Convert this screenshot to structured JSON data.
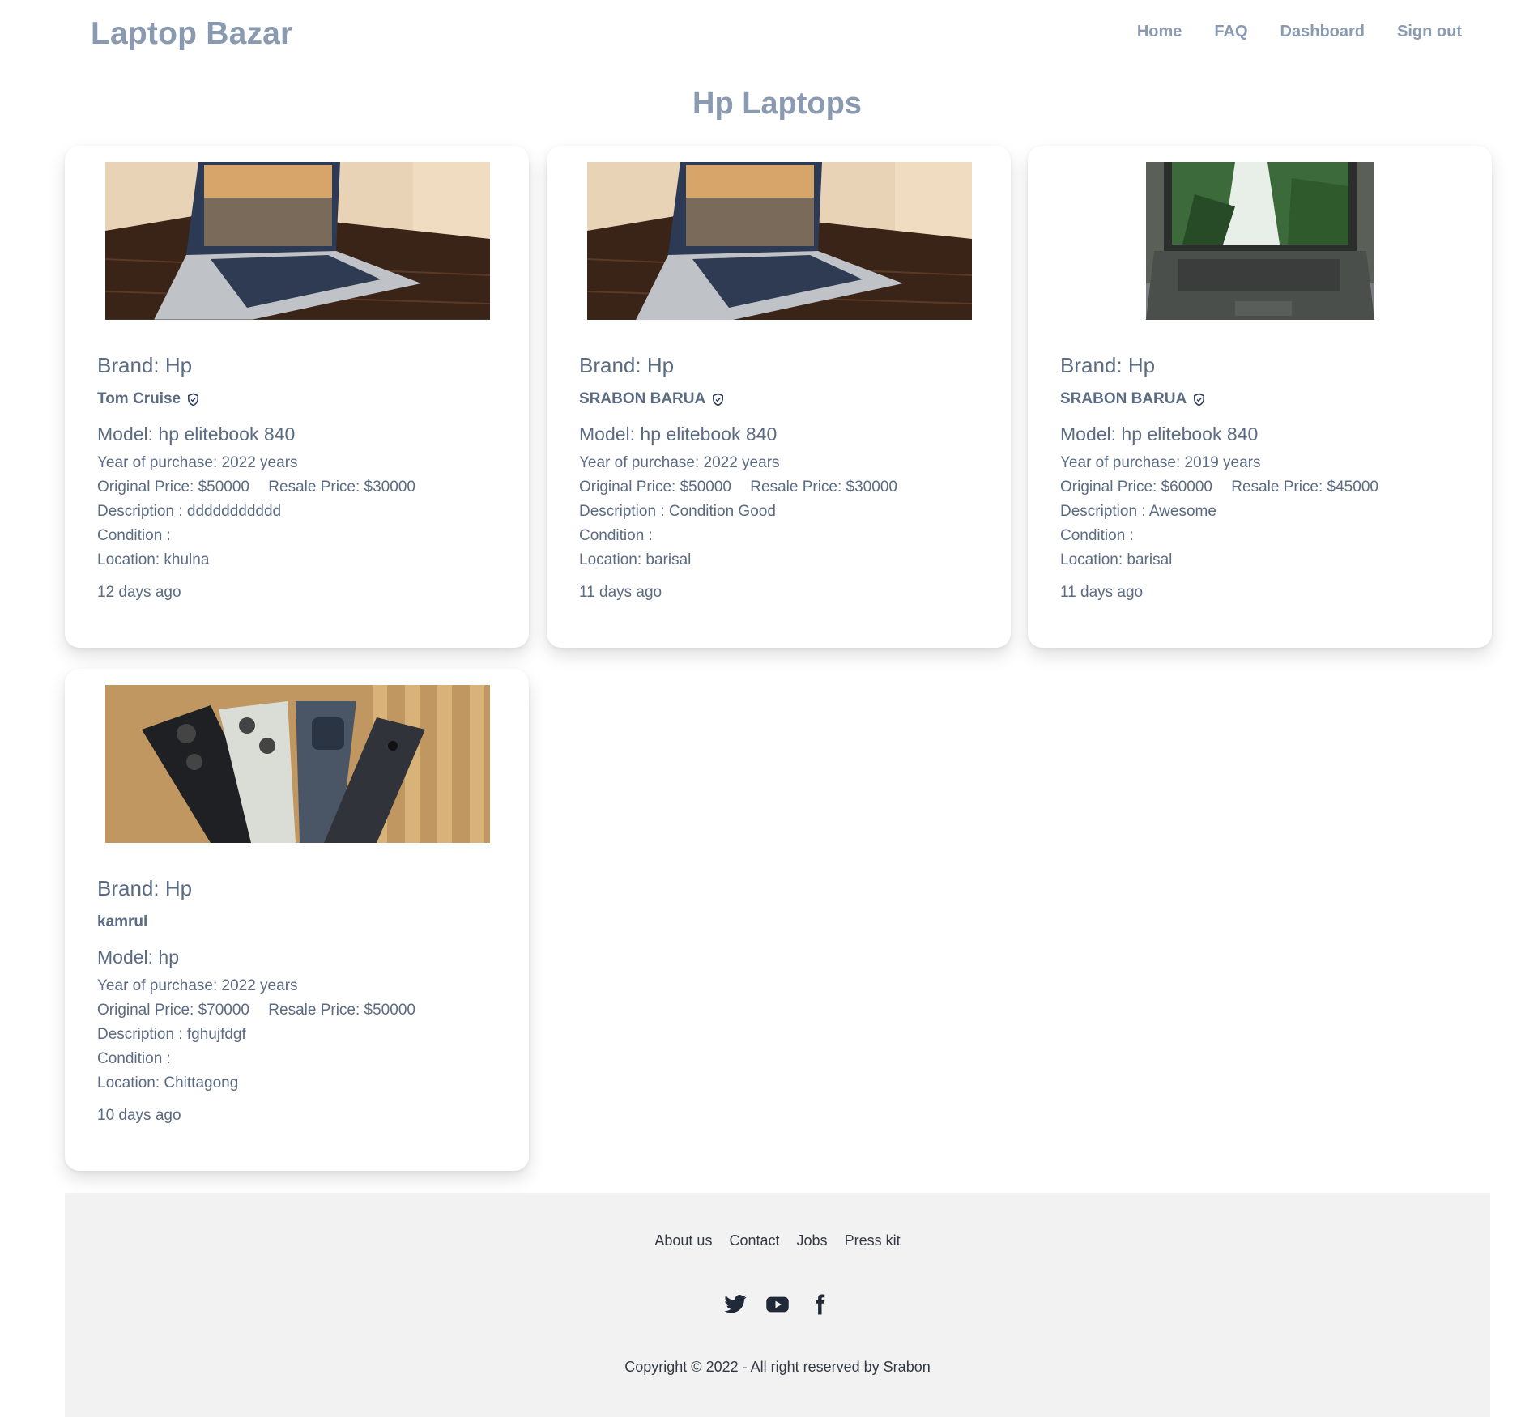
{
  "header": {
    "logo": "Laptop Bazar",
    "nav": [
      "Home",
      "FAQ",
      "Dashboard",
      "Sign out"
    ]
  },
  "page_title": "Hp Laptops",
  "products": [
    {
      "brand": "Brand: Hp",
      "seller": "Tom Cruise",
      "verified": true,
      "model": "Model: hp elitebook 840",
      "year": "Year of purchase: 2022 years",
      "original_price": "Original Price: $50000",
      "resale_price": "Resale Price: $30000",
      "description": "Description : ddddddddddd",
      "condition": "Condition :",
      "location": "Location: khulna",
      "posted": "12 days ago"
    },
    {
      "brand": "Brand: Hp",
      "seller": "SRABON BARUA",
      "verified": true,
      "model": "Model: hp elitebook 840",
      "year": "Year of purchase: 2022 years",
      "original_price": "Original Price: $50000",
      "resale_price": "Resale Price: $30000",
      "description": "Description : Condition Good",
      "condition": "Condition :",
      "location": "Location: barisal",
      "posted": "11 days ago"
    },
    {
      "brand": "Brand: Hp",
      "seller": "SRABON BARUA",
      "verified": true,
      "model": "Model: hp elitebook 840",
      "year": "Year of purchase: 2019 years",
      "original_price": "Original Price: $60000",
      "resale_price": "Resale Price: $45000",
      "description": "Description : Awesome",
      "condition": "Condition :",
      "location": "Location: barisal",
      "posted": "11 days ago"
    },
    {
      "brand": "Brand: Hp",
      "seller": "kamrul",
      "verified": false,
      "model": "Model: hp",
      "year": "Year of purchase: 2022 years",
      "original_price": "Original Price: $70000",
      "resale_price": "Resale Price: $50000",
      "description": "Description : fghujfdgf",
      "condition": "Condition :",
      "location": "Location: Chittagong",
      "posted": "10 days ago"
    }
  ],
  "footer": {
    "links": [
      "About us",
      "Contact",
      "Jobs",
      "Press kit"
    ],
    "social_icons": [
      "twitter-icon",
      "youtube-icon",
      "facebook-icon"
    ],
    "copyright": "Copyright © 2022 - All right reserved by Srabon"
  },
  "colors": {
    "header_text": "#8a9ab1",
    "body_text": "#5b6b82",
    "footer_bg": "#f2f2f2"
  }
}
